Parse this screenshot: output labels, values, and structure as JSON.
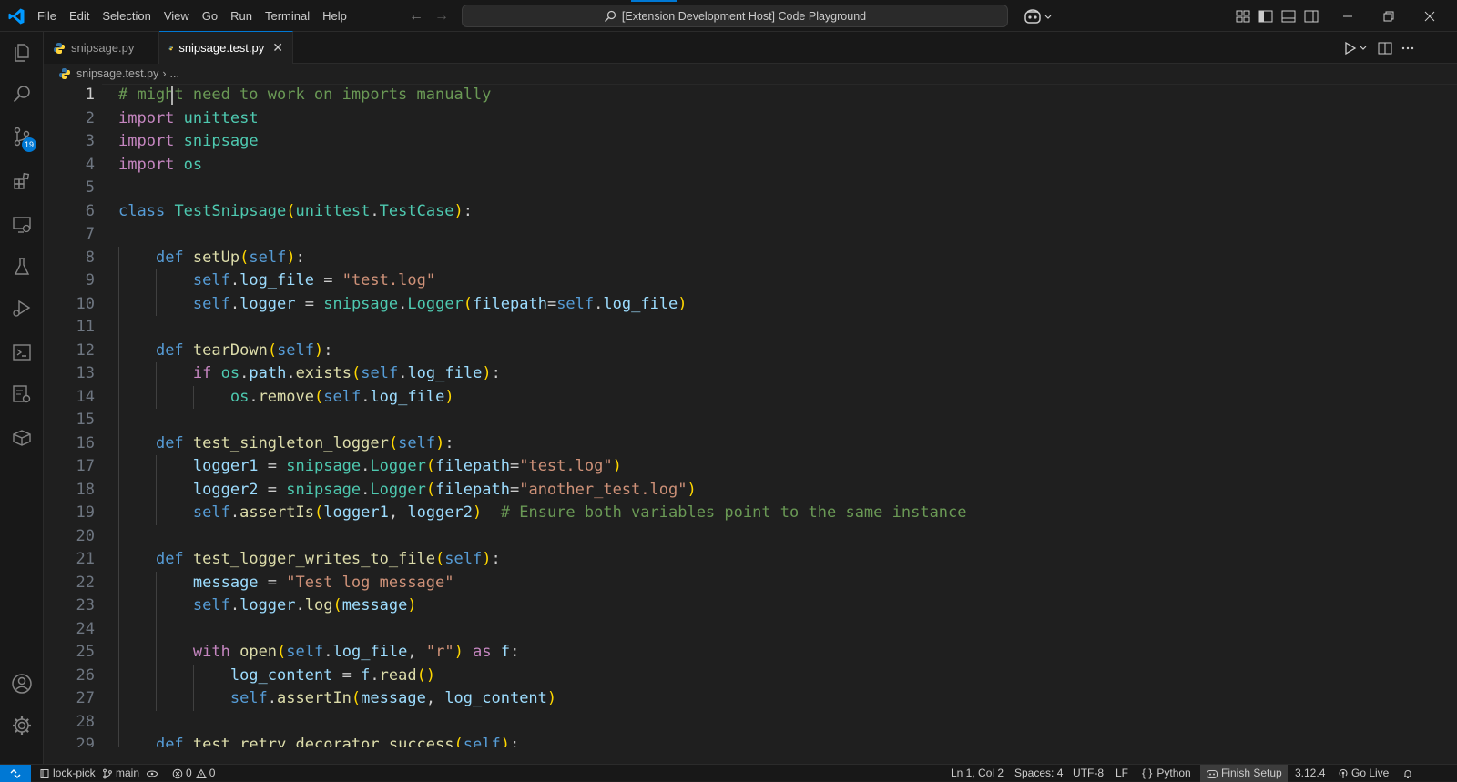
{
  "menu": [
    "File",
    "Edit",
    "Selection",
    "View",
    "Go",
    "Run",
    "Terminal",
    "Help"
  ],
  "command_center": "[Extension Development Host] Code Playground",
  "tabs": [
    {
      "label": "snipsage.py",
      "active": false
    },
    {
      "label": "snipsage.test.py",
      "active": true
    }
  ],
  "breadcrumb": {
    "file": "snipsage.test.py",
    "more": "..."
  },
  "activity": {
    "scm_badge": "19"
  },
  "editor": {
    "line_numbers": [
      "1",
      "2",
      "3",
      "4",
      "5",
      "6",
      "7",
      "8",
      "9",
      "10",
      "11",
      "12",
      "13",
      "14",
      "15",
      "16",
      "17",
      "18",
      "19",
      "20",
      "21",
      "22",
      "23",
      "24",
      "25",
      "26",
      "27",
      "28",
      "29"
    ],
    "lines": [
      "# might need to work on imports manually",
      "import unittest",
      "import snipsage",
      "import os",
      "",
      "class TestSnipsage(unittest.TestCase):",
      "",
      "    def setUp(self):",
      "        self.log_file = \"test.log\"",
      "        self.logger = snipsage.Logger(filepath=self.log_file)",
      "",
      "    def tearDown(self):",
      "        if os.path.exists(self.log_file):",
      "            os.remove(self.log_file)",
      "",
      "    def test_singleton_logger(self):",
      "        logger1 = snipsage.Logger(filepath=\"test.log\")",
      "        logger2 = snipsage.Logger(filepath=\"another_test.log\")",
      "        self.assertIs(logger1, logger2)  # Ensure both variables point to the same instance",
      "",
      "    def test_logger_writes_to_file(self):",
      "        message = \"Test log message\"",
      "        self.logger.log(message)",
      "",
      "        with open(self.log_file, \"r\") as f:",
      "            log_content = f.read()",
      "            self.assertIn(message, log_content)",
      "",
      "    def test_retry_decorator_success(self):"
    ]
  },
  "status": {
    "remote_icon": "remote-icon",
    "repo": "lock-pick",
    "branch": "main",
    "errors": "0",
    "warnings": "0",
    "position": "Ln 1, Col 2",
    "spaces": "Spaces: 4",
    "encoding": "UTF-8",
    "eol": "LF",
    "language": "Python",
    "finish_setup": "Finish Setup",
    "python_version": "3.12.4",
    "go_live": "Go Live"
  },
  "colors": {
    "accent": "#0078d4",
    "keyword": "#c586c0",
    "storage": "#569cd6",
    "function": "#dcdcaa",
    "class": "#4ec9b0",
    "string": "#ce9178",
    "variable": "#9cdcfe",
    "comment": "#6a9955"
  }
}
